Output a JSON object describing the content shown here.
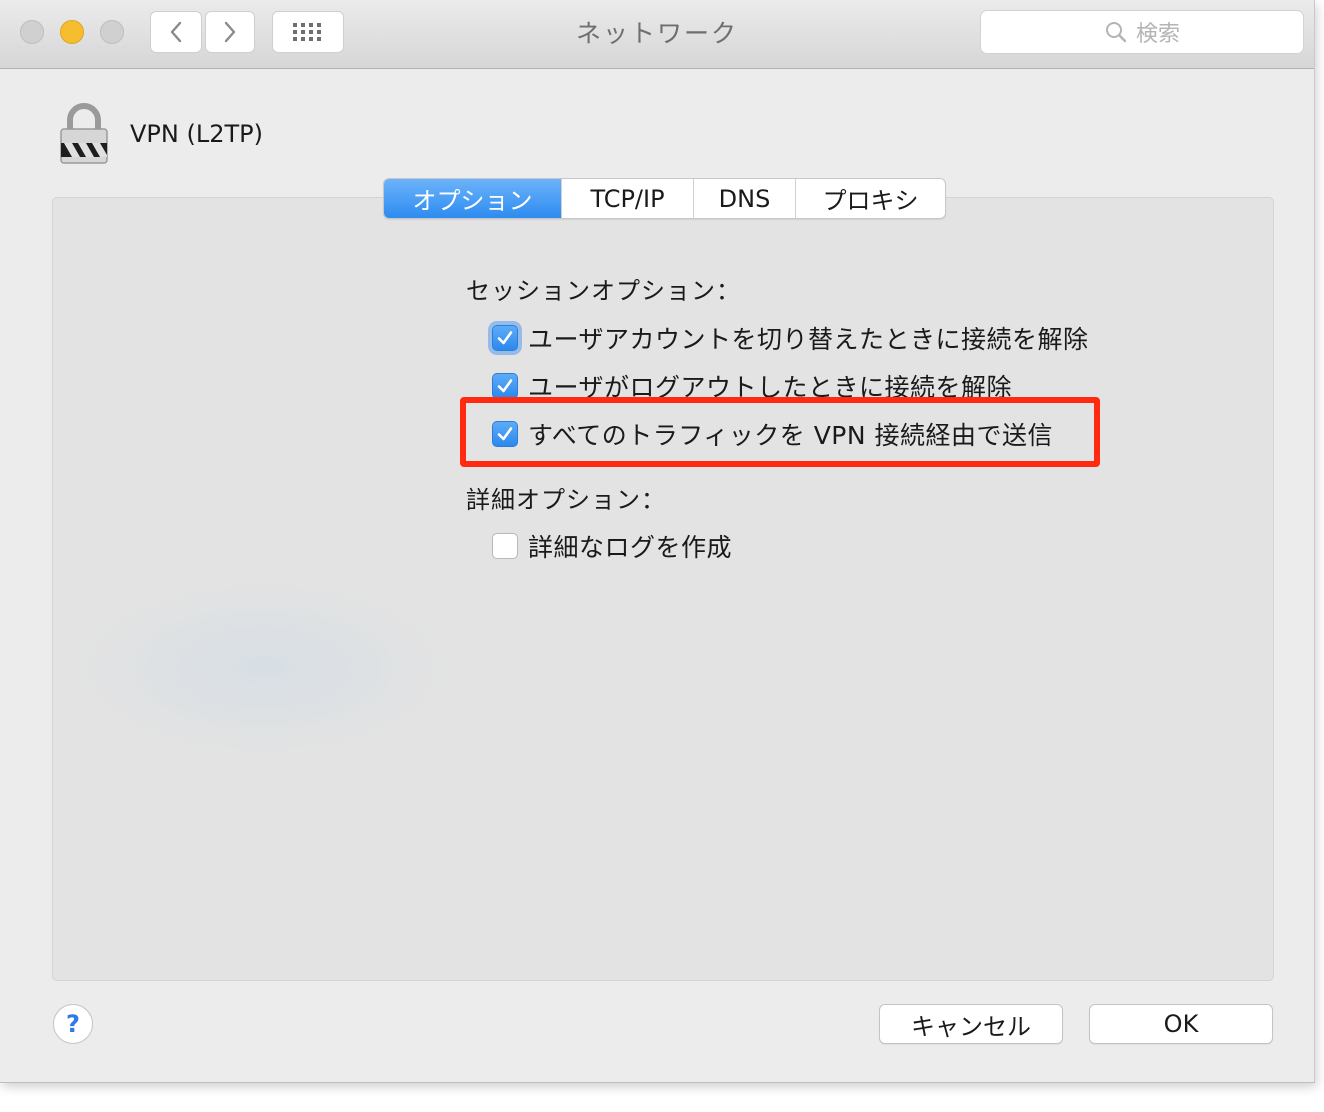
{
  "window": {
    "title": "ネットワーク"
  },
  "search": {
    "placeholder": "検索"
  },
  "header": {
    "service_name": "VPN (L2TP)"
  },
  "tabs": [
    {
      "label": "オプション",
      "active": true
    },
    {
      "label": "TCP/IP",
      "active": false
    },
    {
      "label": "DNS",
      "active": false
    },
    {
      "label": "プロキシ",
      "active": false
    }
  ],
  "session_options": {
    "heading": "セッションオプション：",
    "items": [
      {
        "label": "ユーザアカウントを切り替えたときに接続を解除",
        "checked": true
      },
      {
        "label": "ユーザがログアウトしたときに接続を解除",
        "checked": true
      },
      {
        "label": "すべてのトラフィックを VPN 接続経由で送信",
        "checked": true
      }
    ]
  },
  "advanced_options": {
    "heading": "詳細オプション：",
    "items": [
      {
        "label": "詳細なログを作成",
        "checked": false
      }
    ]
  },
  "buttons": {
    "help": "?",
    "cancel": "キャンセル",
    "ok": "OK"
  },
  "colors": {
    "accent": "#2d8cf0",
    "highlight": "#ff2a10"
  }
}
